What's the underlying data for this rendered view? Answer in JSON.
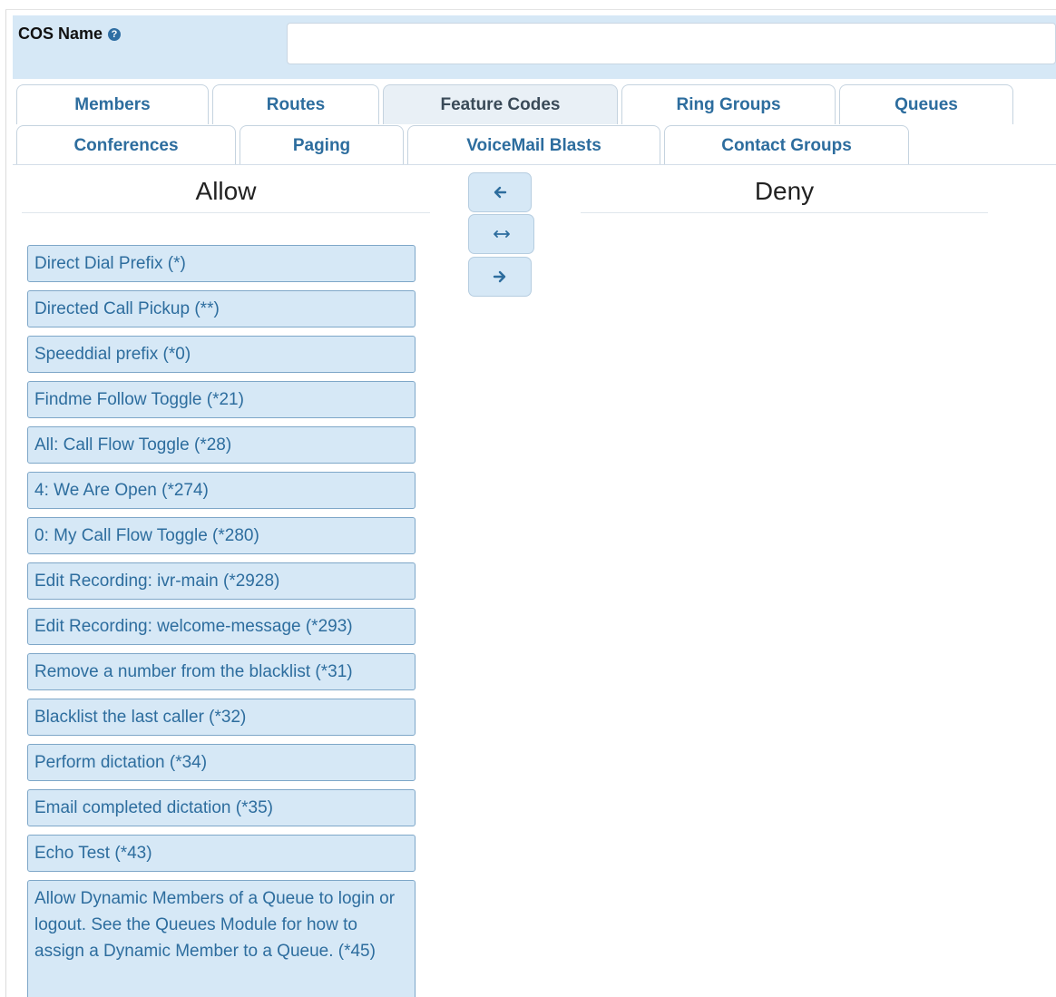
{
  "cos": {
    "label": "COS Name",
    "help_icon": "question-circle-icon",
    "value": ""
  },
  "tabs_row1": [
    {
      "label": "Members"
    },
    {
      "label": "Routes"
    },
    {
      "label": "Feature Codes",
      "active": true
    },
    {
      "label": "Ring Groups"
    },
    {
      "label": "Queues"
    }
  ],
  "tabs_row2": [
    {
      "label": "Conferences"
    },
    {
      "label": "Paging"
    },
    {
      "label": "VoiceMail Blasts"
    },
    {
      "label": "Contact Groups"
    }
  ],
  "allow": {
    "heading": "Allow",
    "items": [
      "Direct Dial Prefix (*)",
      "Directed Call Pickup (**)",
      "Speeddial prefix (*0)",
      "Findme Follow Toggle (*21)",
      "All: Call Flow Toggle (*28)",
      "4: We Are Open (*274)",
      "0: My Call Flow Toggle (*280)",
      "Edit Recording: ivr-main (*2928)",
      "Edit Recording: welcome-message (*293)",
      "Remove a number from the blacklist (*31)",
      "Blacklist the last caller (*32)",
      "Perform dictation (*34)",
      "Email completed dictation (*35)",
      "Echo Test (*43)",
      "Allow Dynamic Members of a Queue to login or logout. See the Queues Module for how to assign a Dynamic Member to a Queue. (*45)"
    ]
  },
  "deny": {
    "heading": "Deny",
    "items": []
  },
  "controls": {
    "move_left_icon": "arrow-left-icon",
    "swap_icon": "arrows-left-right-icon",
    "move_right_icon": "arrow-right-icon"
  },
  "colors": {
    "accent": "#2d6d9e",
    "item_bg": "#d6e8f6",
    "item_border": "#7ea7c8",
    "header_bg": "#d6e8f6"
  }
}
